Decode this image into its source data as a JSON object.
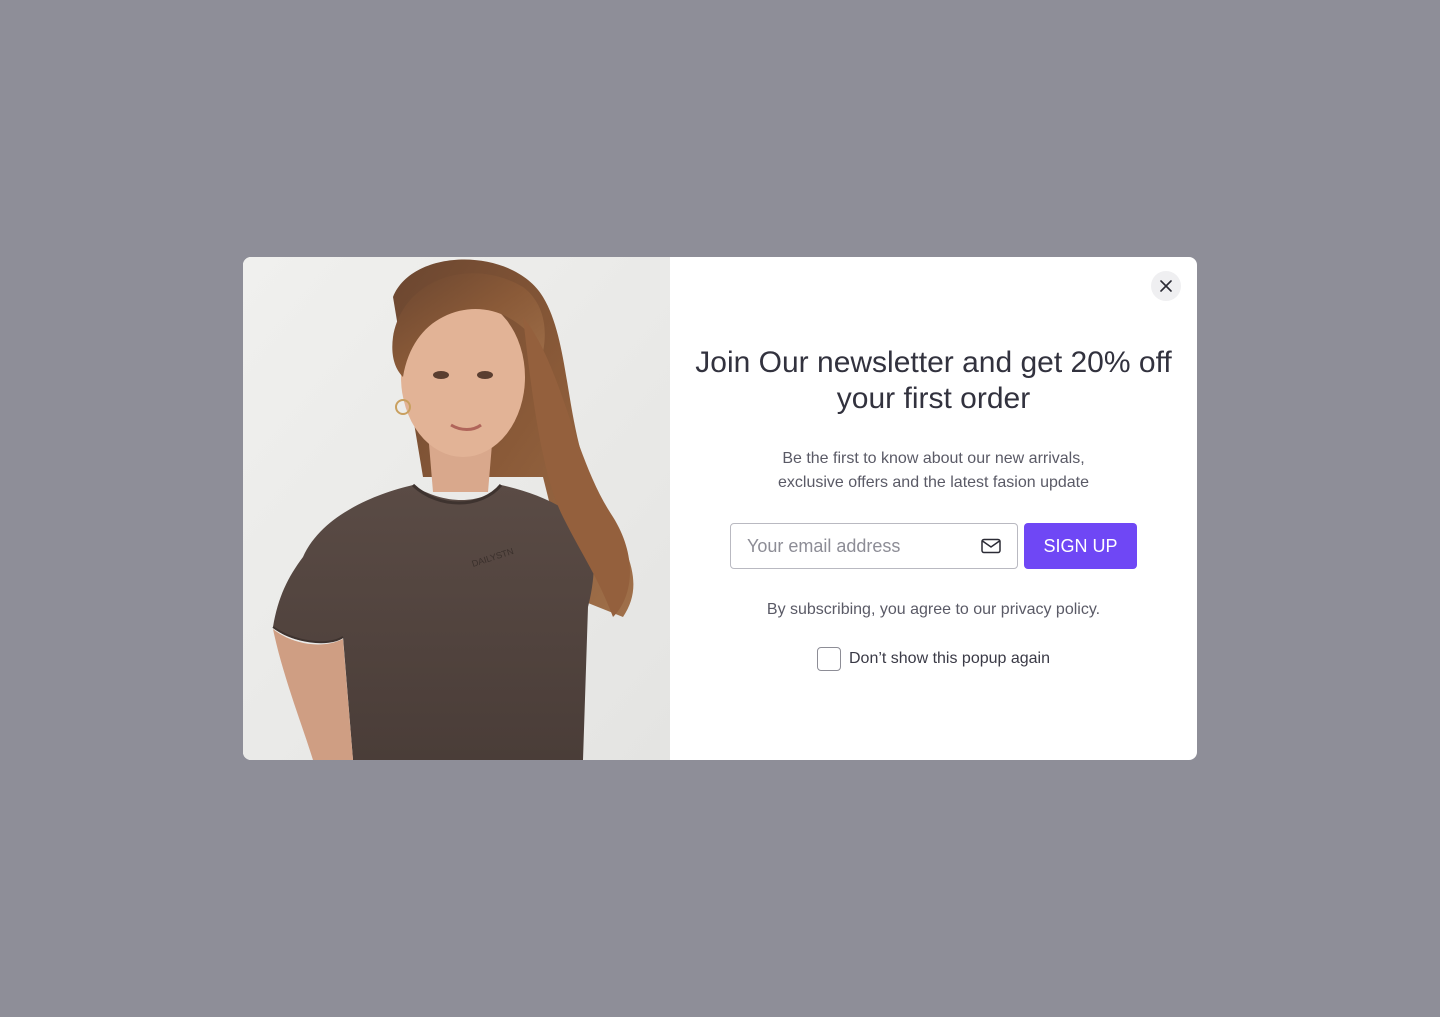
{
  "popup": {
    "headline": "Join Our newsletter and get 20% off your first order",
    "description": "Be the first to know about our new arrivals, exclusive offers and the latest fasion update",
    "email": {
      "placeholder": "Your email address",
      "value": "",
      "icon": "mail-icon"
    },
    "signup_label": "SIGN UP",
    "policy_text": "By subscribing, you agree to our privacy policy.",
    "dont_show_label": "Don’t show this popup again",
    "dont_show_checked": false,
    "close_icon": "close-icon",
    "image": {
      "alt": "Model wearing a brown t-shirt",
      "shirt_text": "DAILYSTN"
    }
  },
  "colors": {
    "overlay": "#8e8e98",
    "accent": "#6f47f5",
    "text_dark": "#32323e",
    "text_muted": "#5a5a66"
  }
}
